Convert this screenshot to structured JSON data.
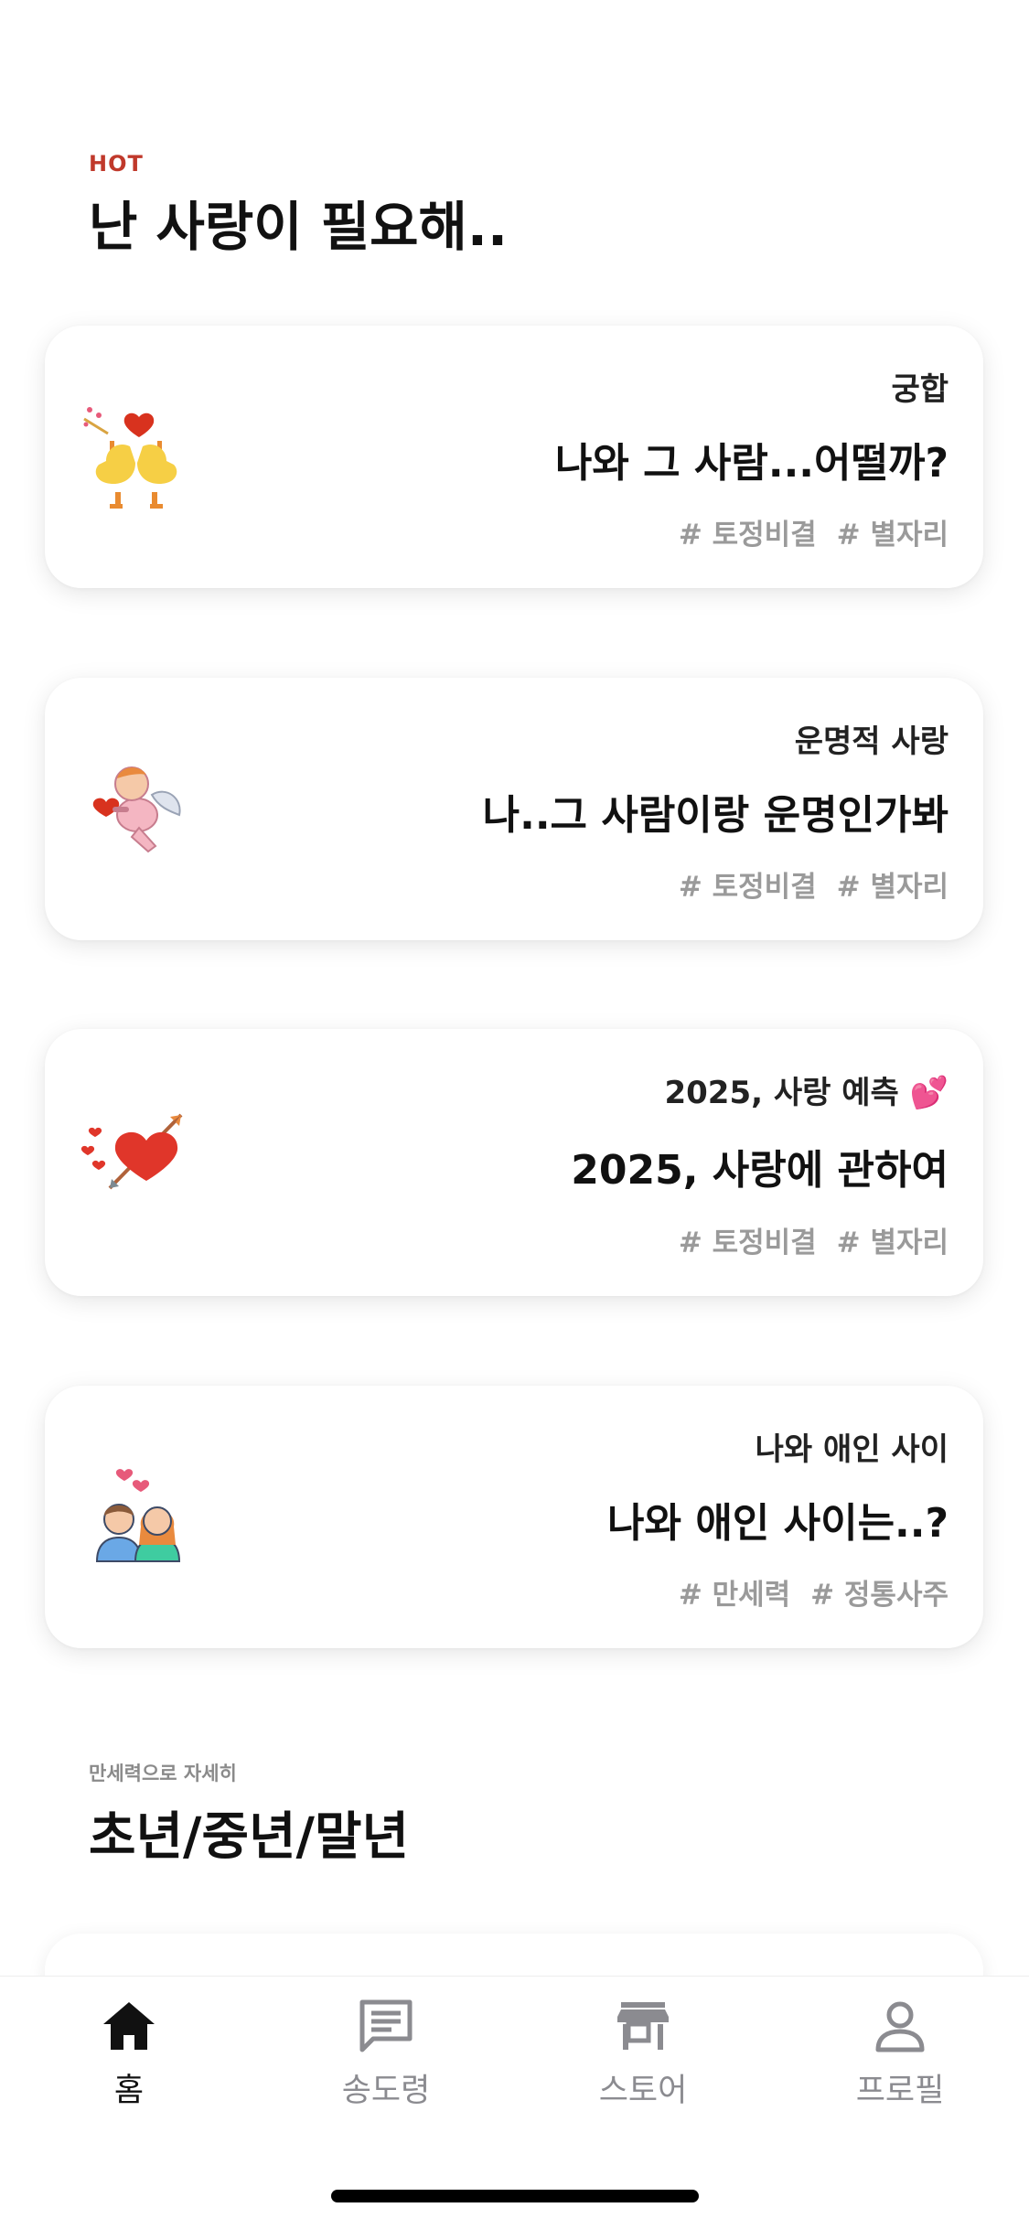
{
  "hot_section": {
    "eyebrow": "HOT",
    "title": "난 사랑이 필요해.."
  },
  "cards": [
    {
      "category": "궁합",
      "title": "나와 그 사람...어떨까?",
      "tags": [
        "# 토정비결",
        "# 별자리"
      ],
      "icon": "ducks-love-icon"
    },
    {
      "category": "운명적 사랑",
      "title": "나..그 사람이랑 운명인가봐",
      "tags": [
        "# 토정비결",
        "# 별자리"
      ],
      "icon": "cupid-icon"
    },
    {
      "category": "2025, 사랑 예측 💕",
      "title": "2025, 사랑에 관하여",
      "tags": [
        "# 토정비결",
        "# 별자리"
      ],
      "icon": "heart-arrow-icon"
    },
    {
      "category": "나와 애인 사이",
      "title": "나와 애인 사이는..?",
      "tags": [
        "# 만세력",
        "# 정통사주"
      ],
      "icon": "couple-icon"
    }
  ],
  "manse_section": {
    "eyebrow": "만세력으로 자세히",
    "title": "초년/중년/말년"
  },
  "tabbar": {
    "active": "홈",
    "tabs": [
      {
        "label": "홈",
        "icon": "home-icon"
      },
      {
        "label": "송도령",
        "icon": "chat-icon"
      },
      {
        "label": "스토어",
        "icon": "store-icon"
      },
      {
        "label": "프로필",
        "icon": "profile-icon"
      }
    ]
  },
  "colors": {
    "hot_accent": "#c0392b",
    "tag_gray": "#9a9a9a",
    "inactive_tab": "#8b8b90",
    "active_tab": "#111111"
  }
}
